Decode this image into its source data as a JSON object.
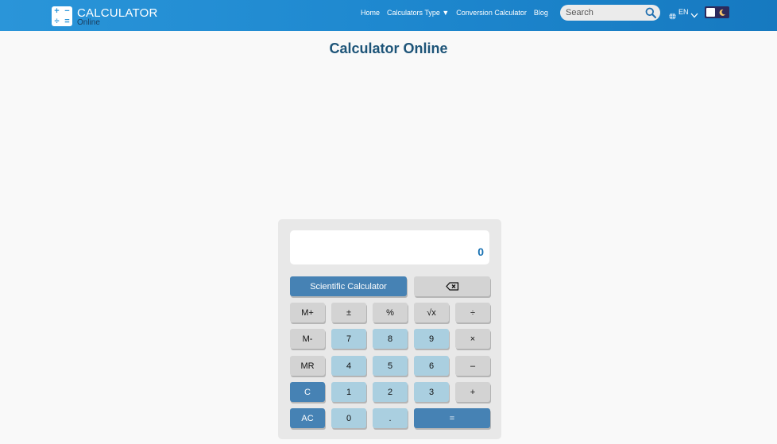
{
  "header": {
    "logo": {
      "icon_symbols": [
        "+",
        "−",
        "÷",
        "="
      ],
      "title": "CALCULATOR",
      "subtitle": "Online"
    },
    "nav": [
      {
        "label": "Home"
      },
      {
        "label": "Calculators Type ▼"
      },
      {
        "label": "Conversion Calculator"
      },
      {
        "label": "Blog"
      }
    ],
    "search": {
      "placeholder": "Search",
      "value": "",
      "icon": "search-icon"
    },
    "language": {
      "label": "EN",
      "icon": "globe-icon"
    },
    "theme_toggle": {
      "icon": "moon-icon"
    }
  },
  "page": {
    "title": "Calculator Online"
  },
  "calculator": {
    "display_value": "0",
    "scientific_label": "Scientific Calculator",
    "backspace_icon": "backspace-icon",
    "rows": [
      [
        "M+",
        "±",
        "%",
        "√x",
        "÷"
      ],
      [
        "M-",
        "7",
        "8",
        "9",
        "×"
      ],
      [
        "MR",
        "4",
        "5",
        "6",
        "–"
      ],
      [
        "C",
        "1",
        "2",
        "3",
        "+"
      ],
      [
        "AC",
        "0",
        ".",
        "="
      ]
    ]
  },
  "colors": {
    "header": "#1e88cf",
    "title": "#1d5478",
    "button_dark": "#4682b4",
    "button_light": "#aacfe0",
    "button_gray": "#d3d3d3",
    "display_text": "#1a72b3"
  }
}
